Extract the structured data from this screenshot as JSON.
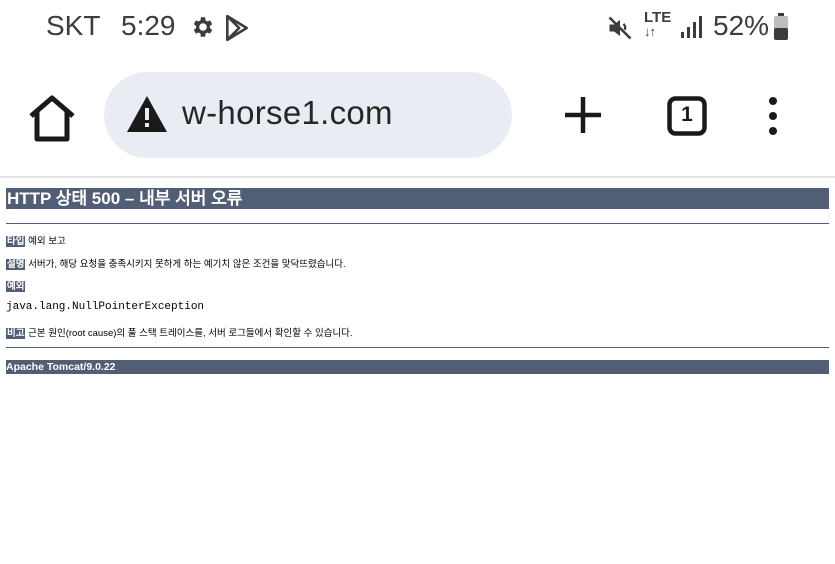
{
  "status_bar": {
    "carrier": "SKT",
    "time": "5:29",
    "network": "LTE",
    "battery": "52%"
  },
  "browser": {
    "url": "w-horse1.com",
    "tab_count": "1"
  },
  "page": {
    "title": "HTTP 상태 500 – 내부 서버 오류",
    "type_label": "타입",
    "type_value": "예외 보고",
    "desc_label": "설명",
    "desc_value": "서버가, 해당 요청을 충족시키지 못하게 하는 예기치 않은 조건을 맞닥뜨렸습니다.",
    "exception_label": "예외",
    "exception_value": "java.lang.NullPointerException",
    "note_label": "비고",
    "note_value": "근본 원인(root cause)의 풀 스택 트레이스를, 서버 로그들에서 확인할 수 있습니다.",
    "footer": "Apache Tomcat/9.0.22"
  },
  "colors": {
    "tomcat_header": "#525d76",
    "url_bar_bg": "#e9edf3"
  },
  "icons": [
    "settings-icon",
    "play-store-icon",
    "mute-icon",
    "signal-icon",
    "battery-icon",
    "home-icon",
    "warning-icon",
    "new-tab-icon",
    "tab-switcher-icon",
    "more-menu-icon"
  ]
}
